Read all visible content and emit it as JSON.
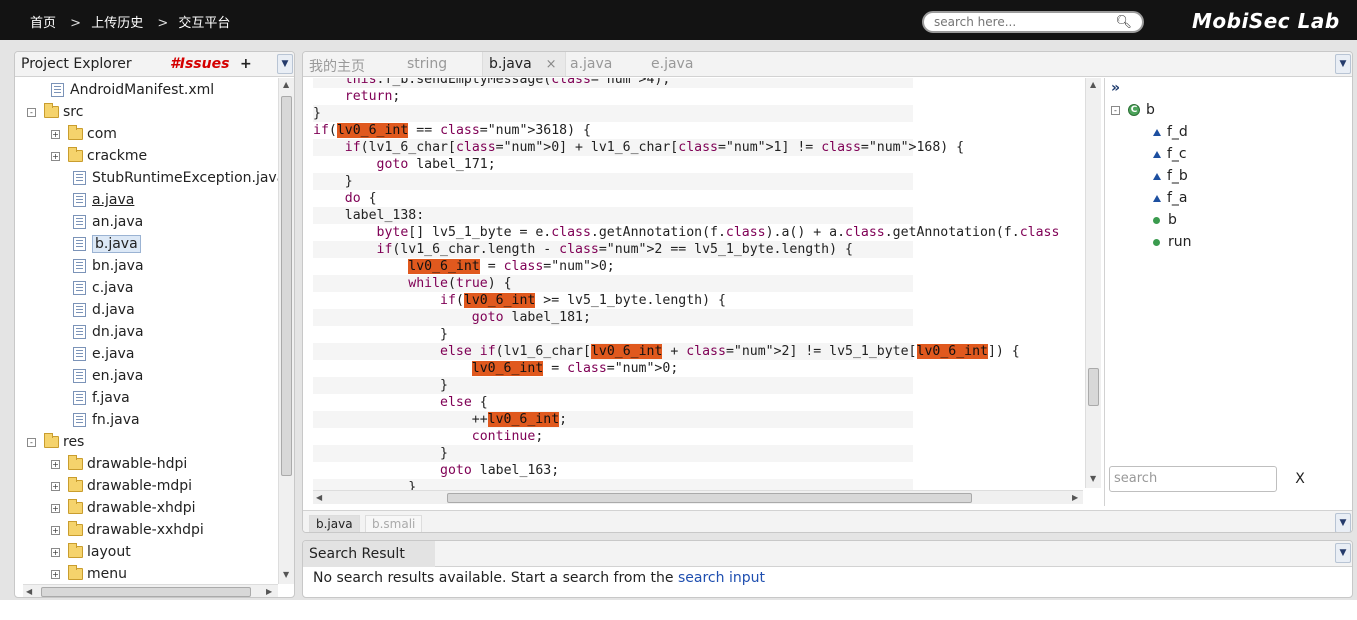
{
  "header": {
    "breadcrumbs": [
      "首页",
      "上传历史",
      "交互平台"
    ],
    "search_placeholder": "search here...",
    "brand": "MobiSec Lab"
  },
  "left": {
    "tabs": {
      "explorer": "Project Explorer",
      "issues": "#Issues",
      "plus": "+"
    },
    "tree": [
      {
        "label": "AndroidManifest.xml",
        "type": "file",
        "depth": 1
      },
      {
        "label": "src",
        "type": "folder",
        "depth": 0,
        "toggle": "-"
      },
      {
        "label": "com",
        "type": "folder",
        "depth": 1,
        "toggle": "+"
      },
      {
        "label": "crackme",
        "type": "folder",
        "depth": 1,
        "toggle": "+"
      },
      {
        "label": "StubRuntimeException.java",
        "type": "file",
        "depth": 2
      },
      {
        "label": "a.java",
        "type": "file",
        "depth": 2,
        "underline": true
      },
      {
        "label": "an.java",
        "type": "file",
        "depth": 2
      },
      {
        "label": "b.java",
        "type": "file",
        "depth": 2,
        "selected": true
      },
      {
        "label": "bn.java",
        "type": "file",
        "depth": 2
      },
      {
        "label": "c.java",
        "type": "file",
        "depth": 2
      },
      {
        "label": "d.java",
        "type": "file",
        "depth": 2
      },
      {
        "label": "dn.java",
        "type": "file",
        "depth": 2
      },
      {
        "label": "e.java",
        "type": "file",
        "depth": 2
      },
      {
        "label": "en.java",
        "type": "file",
        "depth": 2
      },
      {
        "label": "f.java",
        "type": "file",
        "depth": 2
      },
      {
        "label": "fn.java",
        "type": "file",
        "depth": 2
      },
      {
        "label": "res",
        "type": "folder",
        "depth": 0,
        "toggle": "-"
      },
      {
        "label": "drawable-hdpi",
        "type": "folder",
        "depth": 1,
        "toggle": "+"
      },
      {
        "label": "drawable-mdpi",
        "type": "folder",
        "depth": 1,
        "toggle": "+"
      },
      {
        "label": "drawable-xhdpi",
        "type": "folder",
        "depth": 1,
        "toggle": "+"
      },
      {
        "label": "drawable-xxhdpi",
        "type": "folder",
        "depth": 1,
        "toggle": "+"
      },
      {
        "label": "layout",
        "type": "folder",
        "depth": 1,
        "toggle": "+"
      },
      {
        "label": "menu",
        "type": "folder",
        "depth": 1,
        "toggle": "+"
      }
    ]
  },
  "editor": {
    "tabs": [
      "我的主页",
      "string",
      "b.java",
      "a.java",
      "e.java"
    ],
    "active_tab": "b.java",
    "close_glyph": "×",
    "code": [
      "    this.f_b.sendEmptyMessage(4);",
      "    return;",
      "}",
      "if(lv0_6_int == 3618) {",
      "    if(lv1_6_char[0] + lv1_6_char[1] != 168) {",
      "        goto label_171;",
      "    }",
      "    do {",
      "    label_138:",
      "        byte[] lv5_1_byte = e.class.getAnnotation(f.class).a() + a.class.getAnnotation(f.class",
      "        if(lv1_6_char.length - 2 == lv5_1_byte.length) {",
      "            lv0_6_int = 0;",
      "            while(true) {",
      "                if(lv0_6_int >= lv5_1_byte.length) {",
      "                    goto label_181;",
      "                }",
      "                else if(lv1_6_char[lv0_6_int + 2] != lv5_1_byte[lv0_6_int]) {",
      "                    lv0_6_int = 0;",
      "                }",
      "                else {",
      "                    ++lv0_6_int;",
      "                    continue;",
      "                }",
      "                goto label_163;",
      "            }"
    ],
    "highlight_token": "lv0_6_int",
    "structure": {
      "expand": "»",
      "root": "b",
      "members": [
        {
          "label": "f_d",
          "kind": "field"
        },
        {
          "label": "f_c",
          "kind": "field"
        },
        {
          "label": "f_b",
          "kind": "field"
        },
        {
          "label": "f_a",
          "kind": "field"
        },
        {
          "label": "b",
          "kind": "method"
        },
        {
          "label": "run",
          "kind": "method"
        }
      ],
      "search_placeholder": "search",
      "clear_label": "X"
    },
    "bottom_tabs": [
      "b.java",
      "b.smali"
    ]
  },
  "search_result": {
    "tab": "Search Result",
    "message": "No search results available. Start a search from the ",
    "link": "search input"
  },
  "colors": {
    "topbar": "#131313",
    "highlight": "#e0591e",
    "issues": "#d40000",
    "keyword": "#7f0055",
    "number": "#2e8b57",
    "link": "#1f4fb0"
  }
}
